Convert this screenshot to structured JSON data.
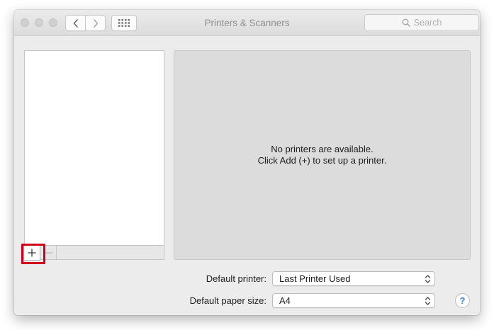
{
  "window": {
    "title": "Printers & Scanners"
  },
  "toolbar": {
    "search_placeholder": "Search"
  },
  "detail": {
    "message_line1": "No printers are available.",
    "message_line2": "Click Add (+) to set up a printer."
  },
  "settings": {
    "default_printer_label": "Default printer:",
    "default_printer_value": "Last Printer Used",
    "default_paper_label": "Default paper size:",
    "default_paper_value": "A4"
  },
  "list_controls": {
    "add_symbol": "+",
    "help_symbol": "?"
  },
  "colors": {
    "highlight": "#d0021b",
    "help_accent": "#3d7fe0"
  },
  "icons": [
    "back-arrow-icon",
    "forward-arrow-icon",
    "grid-icon",
    "search-icon",
    "plus-icon",
    "minus-icon",
    "chevron-updown-icon"
  ]
}
